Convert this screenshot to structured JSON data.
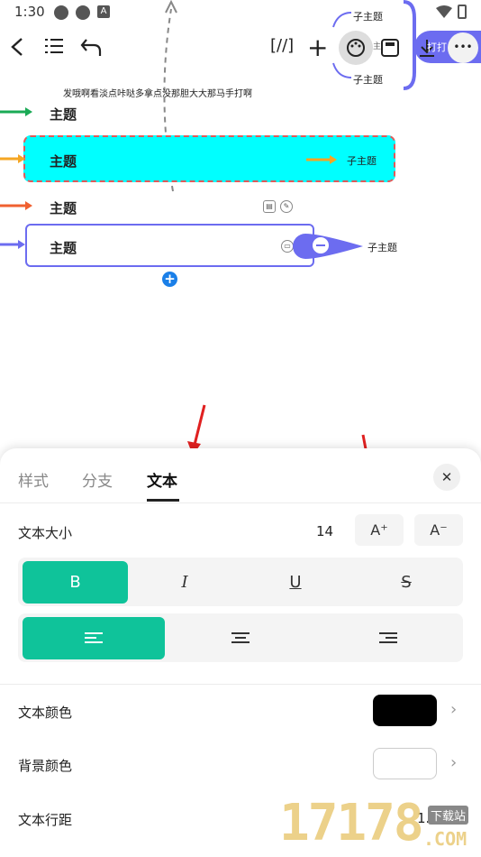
{
  "status_bar": {
    "time": "1:30",
    "a_icon": "A"
  },
  "toolbar": {
    "back_icon": "chevron-left-icon",
    "outline_label": "☰",
    "undo_icon": "undo-icon",
    "bracket_label": "[//]",
    "plus_label": "+",
    "palette_icon": "palette-icon",
    "save_icon": "save-icon",
    "partial_label": "打打",
    "more_label": "•••"
  },
  "map": {
    "note_text": "发哦啊看淡点咔哒多拿点没那胆大大那马手打啊",
    "topics": [
      "主题",
      "主题",
      "主题",
      "主题"
    ],
    "subtopic_labels": [
      "子主题",
      "子主题",
      "子主题",
      "子主题"
    ],
    "side_partial": "主"
  },
  "sheet": {
    "tabs": [
      "样式",
      "分支",
      "文本"
    ],
    "active_tab": "文本",
    "close_label": "✕",
    "font_size_label": "文本大小",
    "font_size_value": "14",
    "increase_label": "A⁺",
    "decrease_label": "A⁻",
    "style_buttons": [
      "B",
      "I",
      "U",
      "S"
    ],
    "align_buttons": [
      "≡",
      "≡",
      "≡"
    ],
    "text_color_label": "文本颜色",
    "text_color": "#000000",
    "bg_color_label": "背景颜色",
    "bg_color": "#ffffff",
    "line_spacing_label": "文本行距",
    "line_spacing_value": "1.0"
  },
  "watermark": {
    "number": "17178",
    "site": "下载站",
    "domain": ".COM"
  },
  "colors": {
    "accent": "#0fc39a",
    "cyan_node": "#00ffff",
    "purple": "#6c6cf0"
  }
}
